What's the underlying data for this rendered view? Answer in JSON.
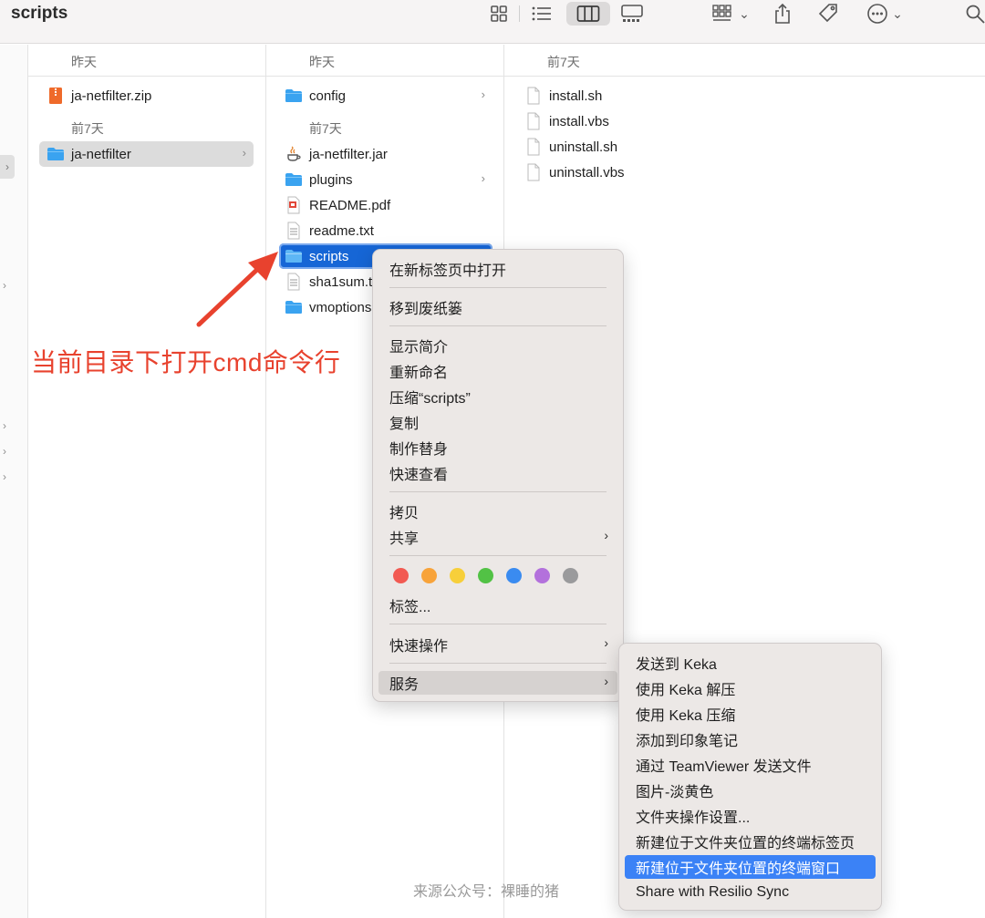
{
  "window": {
    "title": "scripts"
  },
  "toolbar": {
    "icons": [
      "icon-view-icon",
      "list-view-icon",
      "column-view-icon",
      "gallery-view-icon",
      "group-icon",
      "share-icon",
      "tag-icon",
      "more-icon",
      "search-icon"
    ],
    "chevron": "⌄"
  },
  "columns": {
    "c1": {
      "header": "昨天",
      "items": [
        {
          "name": "ja-netfilter.zip",
          "icon": "zip-icon"
        }
      ],
      "section2": "前7天",
      "items2": [
        {
          "name": "ja-netfilter",
          "icon": "folder-icon",
          "chevron": "›"
        }
      ]
    },
    "c2": {
      "header": "昨天",
      "items": [
        {
          "name": "config",
          "icon": "folder-icon",
          "chevron": "›"
        }
      ],
      "section2": "前7天",
      "items2": [
        {
          "name": "ja-netfilter.jar",
          "icon": "java-icon"
        },
        {
          "name": "plugins",
          "icon": "folder-icon",
          "chevron": "›"
        },
        {
          "name": "README.pdf",
          "icon": "pdf-icon"
        },
        {
          "name": "readme.txt",
          "icon": "text-file-icon"
        },
        {
          "name": "scripts",
          "icon": "folder-icon"
        },
        {
          "name": "sha1sum.t",
          "icon": "text-file-icon"
        },
        {
          "name": "vmoptions",
          "icon": "folder-icon"
        }
      ]
    },
    "c3": {
      "header": "前7天",
      "items": [
        {
          "name": "install.sh",
          "icon": "file-icon"
        },
        {
          "name": "install.vbs",
          "icon": "file-icon"
        },
        {
          "name": "uninstall.sh",
          "icon": "file-icon"
        },
        {
          "name": "uninstall.vbs",
          "icon": "file-icon"
        }
      ]
    }
  },
  "sidebar": {
    "chevron": "›"
  },
  "annotation": {
    "text": "当前目录下打开cmd命令行",
    "color": "#e8422e"
  },
  "context_menu": {
    "items": [
      "在新标签页中打开",
      "移到废纸篓",
      "显示简介",
      "重新命名",
      "压缩“scripts”",
      "复制",
      "制作替身",
      "快速查看",
      "拷贝",
      "共享",
      "标签...",
      "快速操作",
      "服务"
    ],
    "submenu_arrow": "›",
    "tag_colors": [
      "#f25a52",
      "#f8a33a",
      "#f7cf3a",
      "#52c245",
      "#3a8bf0",
      "#b371dc",
      "#9a9a9c"
    ]
  },
  "services_menu": {
    "items": [
      "发送到 Keka",
      "使用 Keka 解压",
      "使用 Keka 压缩",
      "添加到印象笔记",
      "通过 TeamViewer 发送文件",
      "图片-淡黄色",
      "文件夹操作设置...",
      "新建位于文件夹位置的终端标签页",
      "新建位于文件夹位置的终端窗口",
      "Share with Resilio Sync"
    ]
  },
  "watermark": "来源公众号：裸睡的猪",
  "colors": {
    "selection_blue": "#1666d6",
    "menu_highlight": "#3b82f6",
    "folder": "#3aa3f0"
  }
}
